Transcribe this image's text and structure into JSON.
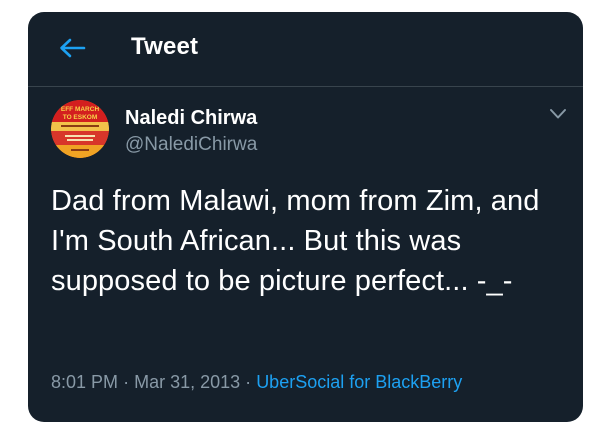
{
  "header": {
    "title": "Tweet",
    "back_icon": "arrow-left-icon"
  },
  "tweet": {
    "author": {
      "name": "Naledi Chirwa",
      "handle": "@NalediChirwa",
      "avatar_text": {
        "line1": "EFF MARCH",
        "line2": "TO ESKOM"
      }
    },
    "text": "Dad from Malawi, mom from Zim, and I'm South African... But this was supposed to be picture perfect... -_-",
    "time": "8:01 PM",
    "separator": "·",
    "date": "Mar 31, 2013",
    "source": "UberSocial for BlackBerry",
    "menu_icon": "chevron-down-icon"
  },
  "colors": {
    "background": "#15202b",
    "text": "#ffffff",
    "secondary": "#8899a6",
    "accent": "#1da1f2",
    "divider": "#38444d"
  }
}
